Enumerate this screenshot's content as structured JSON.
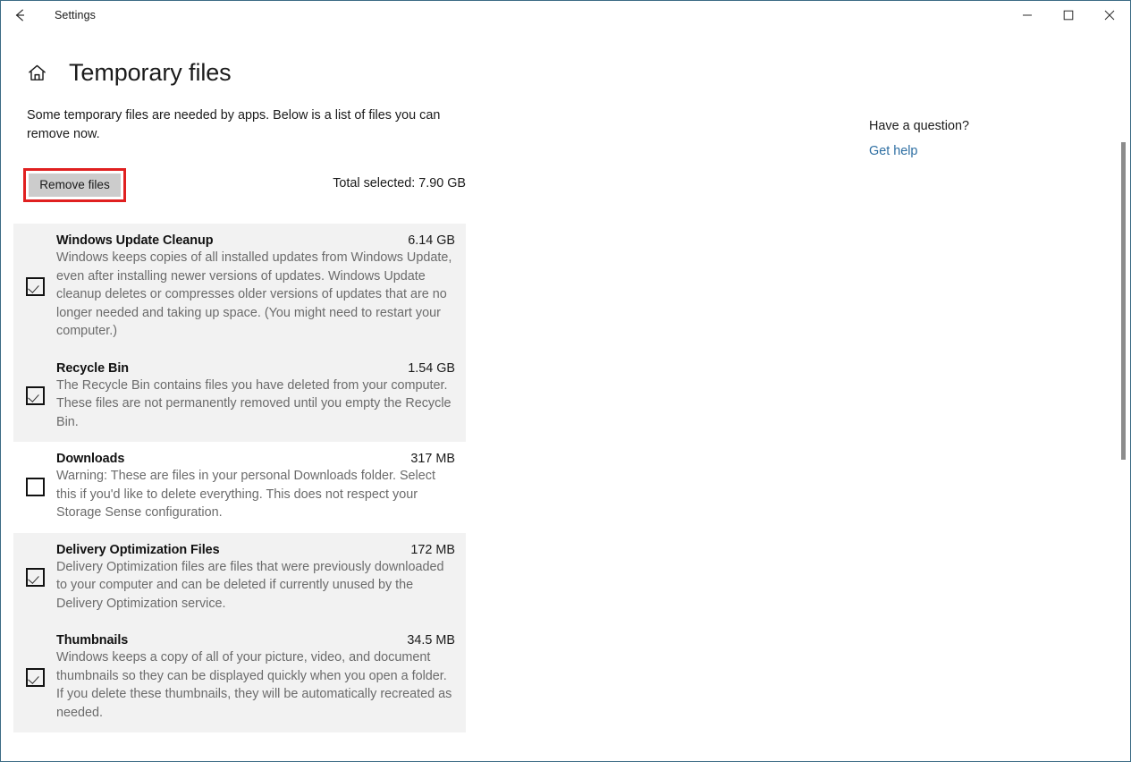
{
  "window": {
    "titlebar_title": "Settings",
    "back_icon": "back-arrow-icon",
    "minimize_icon": "minimize-icon",
    "maximize_icon": "maximize-icon",
    "close_icon": "close-icon",
    "border_color": "#3b6b85"
  },
  "header": {
    "home_icon": "home-icon",
    "page_title": "Temporary files"
  },
  "main": {
    "intro": "Some temporary files are needed by apps. Below is a list of files you can remove now.",
    "remove_button_label": "Remove files",
    "remove_button_highlight_color": "#e02020",
    "total_selected": "Total selected: 7.90 GB"
  },
  "files": [
    {
      "name": "Windows Update Cleanup",
      "size": "6.14 GB",
      "description": "Windows keeps copies of all installed updates from Windows Update, even after installing newer versions of updates. Windows Update cleanup deletes or compresses older versions of updates that are no longer needed and taking up space. (You might need to restart your computer.)",
      "checked": true,
      "shaded": true
    },
    {
      "name": "Recycle Bin",
      "size": "1.54 GB",
      "description": "The Recycle Bin contains files you have deleted from your computer. These files are not permanently removed until you empty the Recycle Bin.",
      "checked": true,
      "shaded": true
    },
    {
      "name": "Downloads",
      "size": "317 MB",
      "description": "Warning: These are files in your personal Downloads folder. Select this if you'd like to delete everything. This does not respect your Storage Sense configuration.",
      "checked": false,
      "shaded": false
    },
    {
      "name": "Delivery Optimization Files",
      "size": "172 MB",
      "description": "Delivery Optimization files are files that were previously downloaded to your computer and can be deleted if currently unused by the Delivery Optimization service.",
      "checked": true,
      "shaded": true
    },
    {
      "name": "Thumbnails",
      "size": "34.5 MB",
      "description": "Windows keeps a copy of all of your picture, video, and document thumbnails so they can be displayed quickly when you open a folder. If you delete these thumbnails, they will be automatically recreated as needed.",
      "checked": true,
      "shaded": true
    }
  ],
  "help": {
    "heading": "Have a question?",
    "link_label": "Get help",
    "link_color": "#2d6ea2"
  },
  "scrollbar": {
    "thumb_color": "#8c8c8c"
  }
}
